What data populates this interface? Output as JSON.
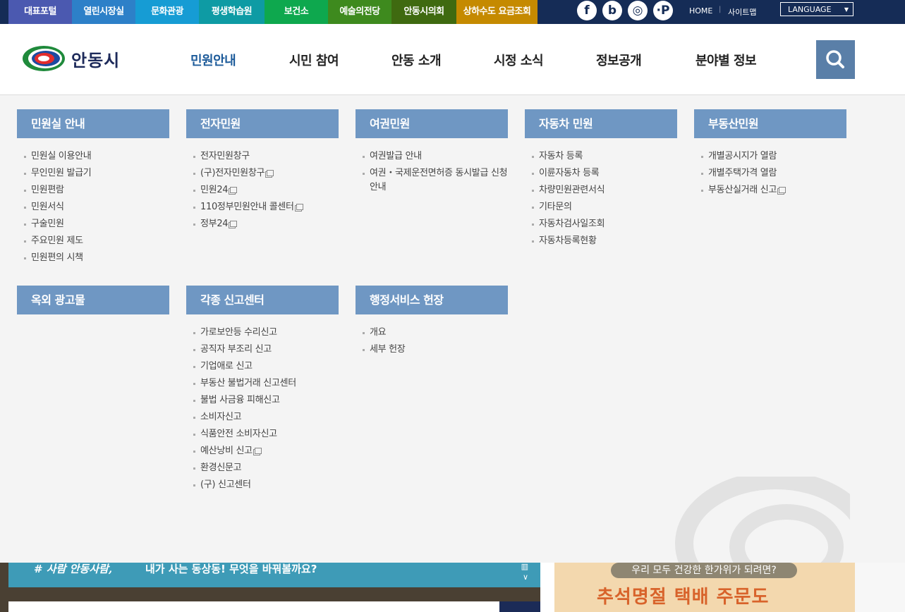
{
  "topbar": {
    "portals": [
      {
        "label": "대표포털",
        "color": "#4b59b0"
      },
      {
        "label": "열린시장실",
        "color": "#2d80c8"
      },
      {
        "label": "문화관광",
        "color": "#169cd4"
      },
      {
        "label": "평생학습원",
        "color": "#0e9ba4"
      },
      {
        "label": "보건소",
        "color": "#0ea84e"
      },
      {
        "label": "예술의전당",
        "color": "#3e8a1e"
      },
      {
        "label": "안동시의회",
        "color": "#3f6a10"
      },
      {
        "label": "상하수도 요금조회",
        "color": "#c58a00"
      }
    ],
    "sns": [
      {
        "icon": "facebook-icon",
        "glyph": "f"
      },
      {
        "icon": "blog-icon",
        "glyph": "b"
      },
      {
        "icon": "instagram-icon",
        "glyph": "◎"
      },
      {
        "icon": "post-icon",
        "glyph": "·P"
      }
    ],
    "home_label": "HOME",
    "sitemap_label": "사이트맵",
    "language_label": "LANGUAGE"
  },
  "header": {
    "logo_text": "안동시",
    "nav": [
      {
        "label": "민원안내",
        "active": true
      },
      {
        "label": "시민 참여",
        "active": false
      },
      {
        "label": "안동 소개",
        "active": false
      },
      {
        "label": "시정 소식",
        "active": false
      },
      {
        "label": "정보공개",
        "active": false
      },
      {
        "label": "분야별 정보",
        "active": false
      }
    ]
  },
  "mega": {
    "columns": [
      {
        "title": "민원실 안내",
        "items": [
          {
            "label": "민원실 이용안내"
          },
          {
            "label": "무인민원 발급기"
          },
          {
            "label": "민원편람"
          },
          {
            "label": "민원서식"
          },
          {
            "label": "구술민원"
          },
          {
            "label": "주요민원 제도"
          },
          {
            "label": "민원편의 시책"
          }
        ]
      },
      {
        "title": "전자민원",
        "items": [
          {
            "label": "전자민원창구"
          },
          {
            "label": "(구)전자민원창구",
            "ext": true
          },
          {
            "label": "민원24",
            "ext": true
          },
          {
            "label": "110정부민원안내 콜센터",
            "ext": true
          },
          {
            "label": "정부24",
            "ext": true
          }
        ]
      },
      {
        "title": "여권민원",
        "items": [
          {
            "label": "여권발급 안내"
          },
          {
            "label": "여권・국제운전면허증 동시발급 신청안내"
          }
        ]
      },
      {
        "title": "자동차 민원",
        "items": [
          {
            "label": "자동차 등록"
          },
          {
            "label": "이륜자동차 등록"
          },
          {
            "label": "차량민원관련서식"
          },
          {
            "label": "기타문의"
          },
          {
            "label": "자동차검사일조회"
          },
          {
            "label": "자동차등록현황"
          }
        ]
      },
      {
        "title": "부동산민원",
        "items": [
          {
            "label": "개별공시지가 열람"
          },
          {
            "label": "개별주택가격 열람"
          },
          {
            "label": "부동산실거래 신고",
            "ext": true
          }
        ]
      },
      {
        "title": "옥외 광고물",
        "items": []
      },
      {
        "title": "각종 신고센터",
        "items": [
          {
            "label": "가로보안등 수리신고"
          },
          {
            "label": "공직자 부조리 신고"
          },
          {
            "label": "기업애로 신고"
          },
          {
            "label": "부동산 불법거래 신고센터"
          },
          {
            "label": "불법 사금융 피해신고"
          },
          {
            "label": "소비자신고"
          },
          {
            "label": "식품안전 소비자신고"
          },
          {
            "label": "예산낭비 신고",
            "ext": true
          },
          {
            "label": "환경신문고"
          },
          {
            "label": "(구) 신고센터"
          }
        ]
      },
      {
        "title": "행정서비스 헌장",
        "items": [
          {
            "label": "개요"
          },
          {
            "label": "세부 헌장"
          }
        ]
      }
    ]
  },
  "bottom": {
    "hashtag": "# 사람 안동사람,",
    "message": "내가 사는 동상동! 무엇을 바꿔볼까요?",
    "banner_question": "우리 모두 건강한 한가위가 되려면?",
    "banner_big": "추석명절 택배 주문도"
  }
}
